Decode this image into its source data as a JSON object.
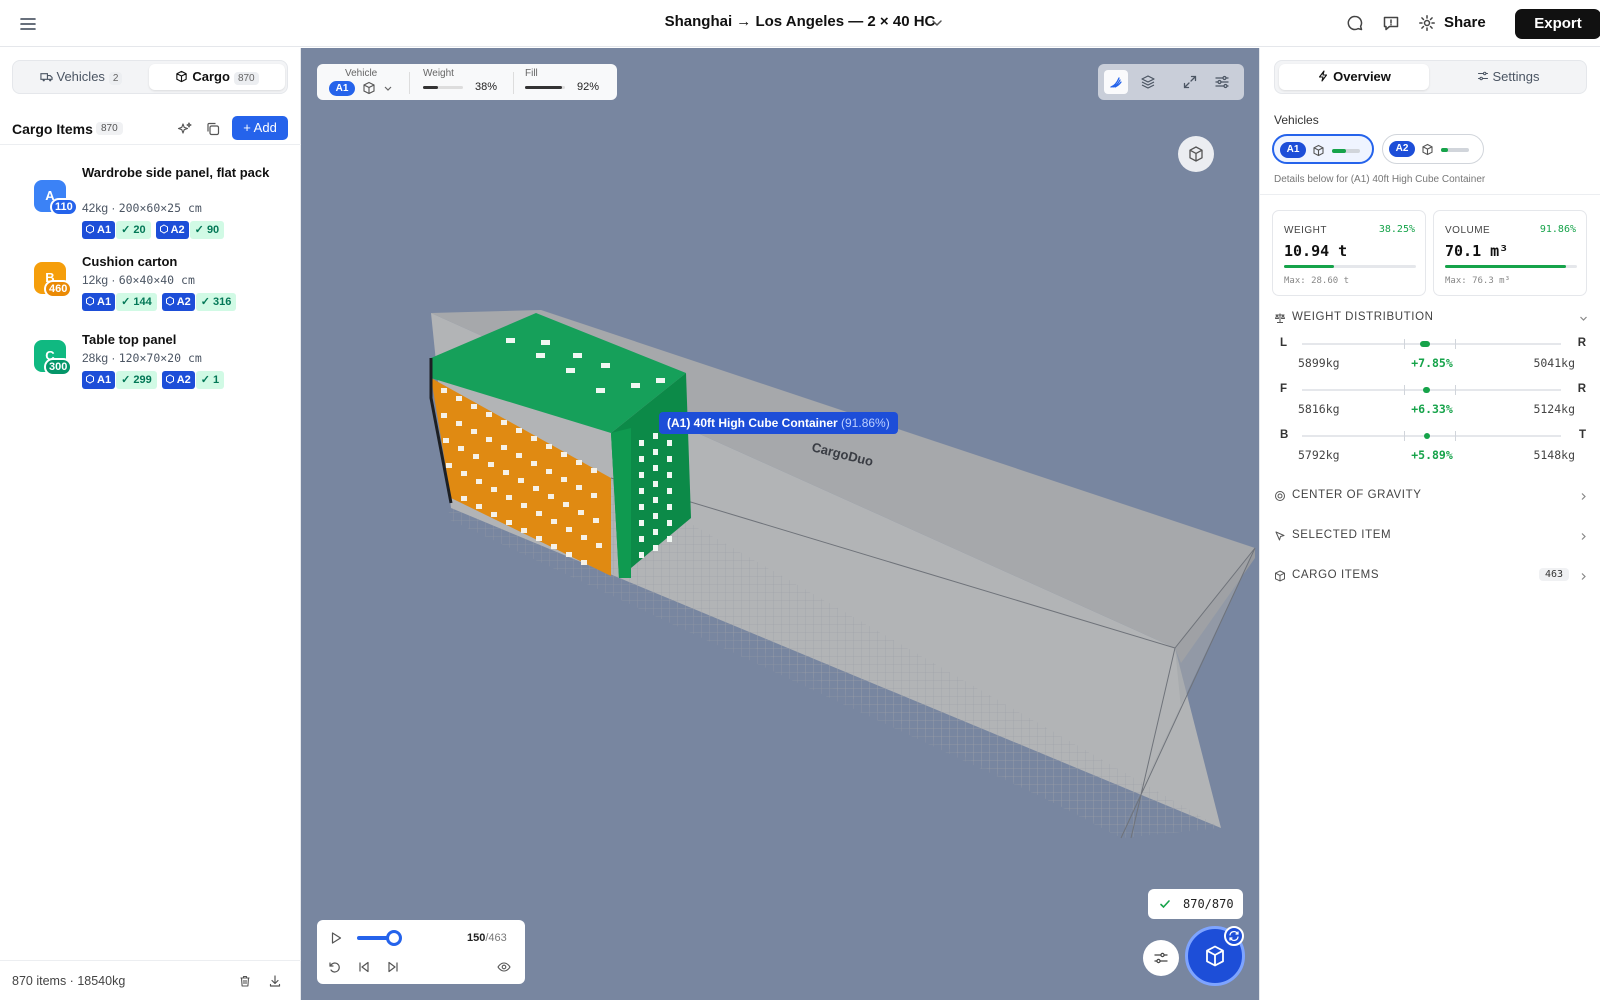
{
  "header": {
    "title": "Shanghai → Los Angeles — 2 × 40 HC",
    "share": "Share",
    "export": "Export"
  },
  "left_panel": {
    "tabs": [
      {
        "label": "Vehicles",
        "count": "2"
      },
      {
        "label": "Cargo",
        "count": "870"
      }
    ],
    "cargo_items_title": "Cargo Items",
    "cargo_items_count": "870",
    "add_label": "+ Add",
    "items": [
      {
        "letter": "A",
        "color": "#3b82f6",
        "badge": "110",
        "badge_color": "#2563eb",
        "name": "Wardrobe side panel, flat pack",
        "weight": "42kg",
        "dims": "200×60×25 cm",
        "allocations": [
          {
            "vehicle": "A1",
            "count": "20"
          },
          {
            "vehicle": "A2",
            "count": "90"
          }
        ]
      },
      {
        "letter": "B",
        "color": "#f59e0b",
        "badge": "460",
        "badge_color": "#ea8a05",
        "name": "Cushion carton",
        "weight": "12kg",
        "dims": "60×40×40 cm",
        "allocations": [
          {
            "vehicle": "A1",
            "count": "144"
          },
          {
            "vehicle": "A2",
            "count": "316"
          }
        ]
      },
      {
        "letter": "C",
        "color": "#10b981",
        "badge": "300",
        "badge_color": "#059669",
        "name": "Table top panel",
        "weight": "28kg",
        "dims": "120×70×20 cm",
        "allocations": [
          {
            "vehicle": "A1",
            "count": "299"
          },
          {
            "vehicle": "A2",
            "count": "1"
          }
        ]
      }
    ],
    "footer": {
      "items": "870 items",
      "weight": "18540kg"
    }
  },
  "viewport": {
    "stats": {
      "vehicle_label": "Vehicle",
      "vehicle": "A1",
      "weight_label": "Weight",
      "weight": "38%",
      "weight_fraction": 0.38,
      "fill_label": "Fill",
      "fill": "92%",
      "fill_fraction": 0.92
    },
    "container_label": "(A1) 40ft High Cube Container",
    "container_pct": "(91.86%)",
    "watermark": "CargoDuo",
    "player": {
      "current": "150",
      "total": "/463",
      "progress": 0.324
    },
    "placed": "870/870"
  },
  "right_panel": {
    "tabs": [
      "Overview",
      "Settings"
    ],
    "vehicles_label": "Vehicles",
    "vehicles": [
      {
        "id": "A1",
        "fill": 0.5
      },
      {
        "id": "A2",
        "fill": 0.25
      }
    ],
    "details_note": "Details below for (A1) 40ft High Cube Container",
    "weight": {
      "label": "WEIGHT",
      "pct": "38.25%",
      "value": "10.94 t",
      "fraction": 0.3825,
      "max": "Max: 28.60 t"
    },
    "volume": {
      "label": "VOLUME",
      "pct": "91.86%",
      "value": "70.1 m³",
      "fraction": 0.9186,
      "max": "Max: 76.3 m³"
    },
    "weight_distribution": {
      "title": "WEIGHT DISTRIBUTION",
      "rows": [
        {
          "a": "L",
          "b": "R",
          "left": "5899kg",
          "diff": "+7.85%",
          "right": "5041kg"
        },
        {
          "a": "F",
          "b": "R",
          "left": "5816kg",
          "diff": "+6.33%",
          "right": "5124kg"
        },
        {
          "a": "B",
          "b": "T",
          "left": "5792kg",
          "diff": "+5.89%",
          "right": "5148kg"
        }
      ]
    },
    "sections": [
      {
        "title": "CENTER OF GRAVITY"
      },
      {
        "title": "SELECTED ITEM"
      },
      {
        "title": "CARGO ITEMS",
        "count": "463"
      }
    ]
  }
}
